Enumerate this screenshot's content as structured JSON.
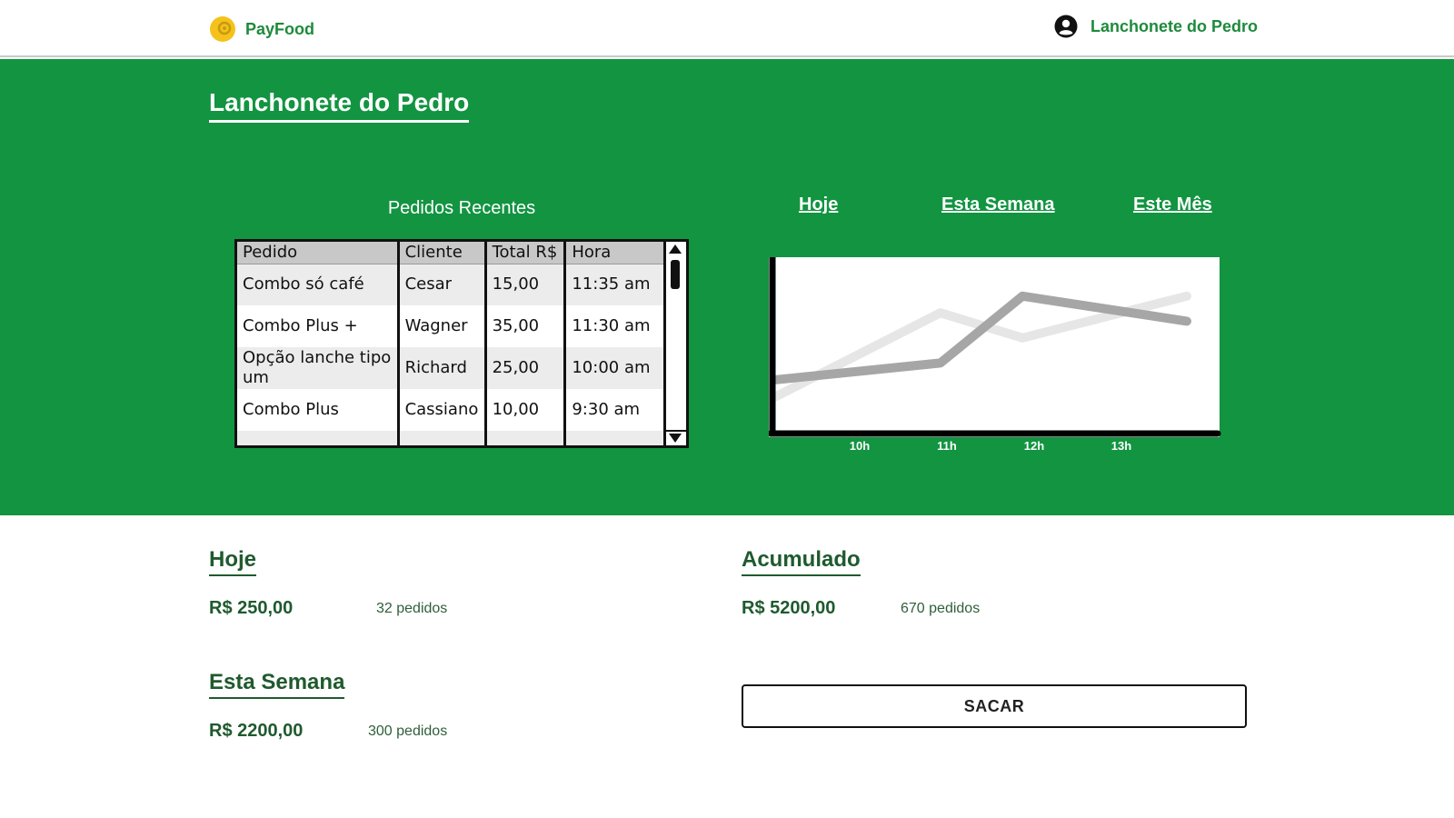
{
  "header": {
    "brand_name": "PayFood",
    "user_name": "Lanchonete do Pedro",
    "logo_color": "#f5c21b",
    "brand_color": "#1e8a3c",
    "logo_icon": "payfood-logo-icon",
    "user_icon": "user-avatar-icon"
  },
  "hero": {
    "title": "Lanchonete do Pedro",
    "background": "#129441",
    "recent": {
      "title": "Pedidos Recentes",
      "columns": [
        "Pedido",
        "Cliente",
        "Total R$",
        "Hora"
      ],
      "rows": [
        [
          "Combo só café",
          "Cesar",
          "15,00",
          "11:35 am"
        ],
        [
          "Combo Plus +",
          "Wagner",
          "35,00",
          "11:30 am"
        ],
        [
          "Opção lanche tipo um",
          "Richard",
          "25,00",
          "10:00 am"
        ],
        [
          "Combo Plus",
          "Cassiano",
          "10,00",
          "9:30 am"
        ]
      ]
    },
    "tabs": [
      "Hoje",
      "Esta Semana",
      "Este Mês"
    ]
  },
  "chart_data": {
    "type": "line",
    "categories": [
      "10h",
      "11h",
      "12h",
      "13h"
    ],
    "series": [
      {
        "color": "#e6e6e6",
        "values": [
          2,
          7,
          5.5,
          8
        ]
      },
      {
        "color": "#a6a6a6",
        "values": [
          3,
          4,
          8,
          6.5
        ]
      }
    ],
    "grid": false,
    "ylim": [
      0,
      10
    ],
    "title": "",
    "xlabel": "",
    "ylabel": ""
  },
  "summary": {
    "today": {
      "title": "Hoje",
      "amount": "R$ 250,00",
      "orders": "32 pedidos"
    },
    "week": {
      "title": "Esta Semana",
      "amount": "R$ 2200,00",
      "orders": "300 pedidos"
    },
    "total": {
      "title": "Acumulado",
      "amount": "R$ 5200,00",
      "orders": "670 pedidos"
    },
    "withdraw_label": "SACAR"
  }
}
